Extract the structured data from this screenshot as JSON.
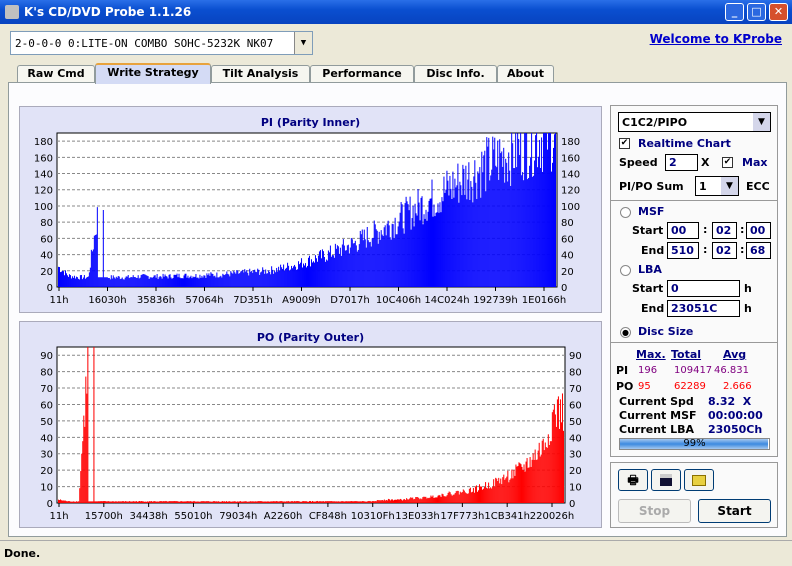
{
  "window": {
    "title": "K's CD/DVD Probe 1.1.26",
    "minimize": "_",
    "maximize": "□",
    "close": "✕"
  },
  "device": {
    "selected": "2-0-0-0 0:LITE-ON COMBO SOHC-5232K NK07"
  },
  "welcome_link": "Welcome to KProbe",
  "tabs": [
    {
      "label": "Raw Cmd"
    },
    {
      "label": "Write Strategy",
      "active": true
    },
    {
      "label": "Tilt Analysis"
    },
    {
      "label": "Performance"
    },
    {
      "label": "Disc Info."
    },
    {
      "label": "About"
    }
  ],
  "chart_data": [
    {
      "type": "bar",
      "title": "PI (Parity Inner)",
      "ylim": [
        0,
        190
      ],
      "yticks": [
        0,
        20,
        40,
        60,
        80,
        100,
        120,
        140,
        160,
        180
      ],
      "xticks": [
        "11h",
        "16030h",
        "35836h",
        "57064h",
        "7D351h",
        "A9009h",
        "D7017h",
        "10C406h",
        "14C024h",
        "192739h",
        "1E0166h"
      ],
      "color": "#0000ff",
      "grid": true,
      "values": [
        25,
        14,
        12,
        12,
        95,
        12,
        12,
        12,
        13,
        13,
        13,
        13,
        14,
        14,
        14,
        15,
        15,
        16,
        17,
        18,
        19,
        20,
        22,
        25,
        28,
        32,
        36,
        40,
        45,
        50,
        55,
        62,
        68,
        75,
        82,
        90,
        98,
        105,
        112,
        120,
        128,
        135,
        142,
        150,
        157,
        163,
        170,
        176,
        182,
        188
      ]
    },
    {
      "type": "bar",
      "title": "PO (Parity Outer)",
      "ylim": [
        0,
        95
      ],
      "yticks": [
        0,
        10,
        20,
        30,
        40,
        50,
        60,
        70,
        80,
        90
      ],
      "xticks": [
        "11h",
        "15700h",
        "34438h",
        "55010h",
        "79034h",
        "A2260h",
        "CF848h",
        "10310Fh",
        "13E033h",
        "17F773h",
        "1CB341h",
        "220026h"
      ],
      "color": "#ff0000",
      "grid": true,
      "values": [
        2,
        1,
        1,
        95,
        1,
        1,
        1,
        1,
        1,
        1,
        1,
        1,
        1,
        1,
        1,
        1,
        1,
        1,
        1,
        1,
        1,
        1,
        1,
        1,
        1,
        1,
        1,
        1,
        1,
        1,
        1,
        1,
        2,
        2,
        2,
        3,
        3,
        4,
        5,
        6,
        7,
        8,
        10,
        12,
        15,
        18,
        22,
        28,
        35,
        55
      ]
    }
  ],
  "controls": {
    "mode": "C1C2/PIPO",
    "realtime_label": "Realtime Chart",
    "realtime_checked": true,
    "speed_label": "Speed",
    "speed": "2",
    "speed_unit": "X",
    "max_label": "Max",
    "max_checked": true,
    "sum_label": "PI/PO Sum",
    "sum": "1",
    "ecc_label": "ECC",
    "msf_label": "MSF",
    "start_label": "Start",
    "end_label": "End",
    "msf_start": [
      "00",
      "02",
      "00"
    ],
    "msf_end": [
      "510",
      "02",
      "68"
    ],
    "lba_label": "LBA",
    "lba_start": "0",
    "lba_end": "23051C",
    "h": "h",
    "disc_size_label": "Disc Size",
    "selected_range": "Disc Size"
  },
  "stats": {
    "headers": {
      "max": "Max.",
      "total": "Total",
      "avg": "Avg"
    },
    "pi": {
      "label": "PI",
      "max": "196",
      "total": "109417",
      "avg": "46.831"
    },
    "po": {
      "label": "PO",
      "max": "95",
      "total": "62289",
      "avg": "2.666"
    },
    "current_spd_label": "Current Spd",
    "current_spd": "8.32  X",
    "current_msf_label": "Current MSF",
    "current_msf": "00:00:00",
    "current_lba_label": "Current LBA",
    "current_lba": "23050Ch",
    "progress": "99%",
    "progress_value": 99
  },
  "buttons": {
    "stop": "Stop",
    "start": "Start"
  },
  "status": "Done."
}
